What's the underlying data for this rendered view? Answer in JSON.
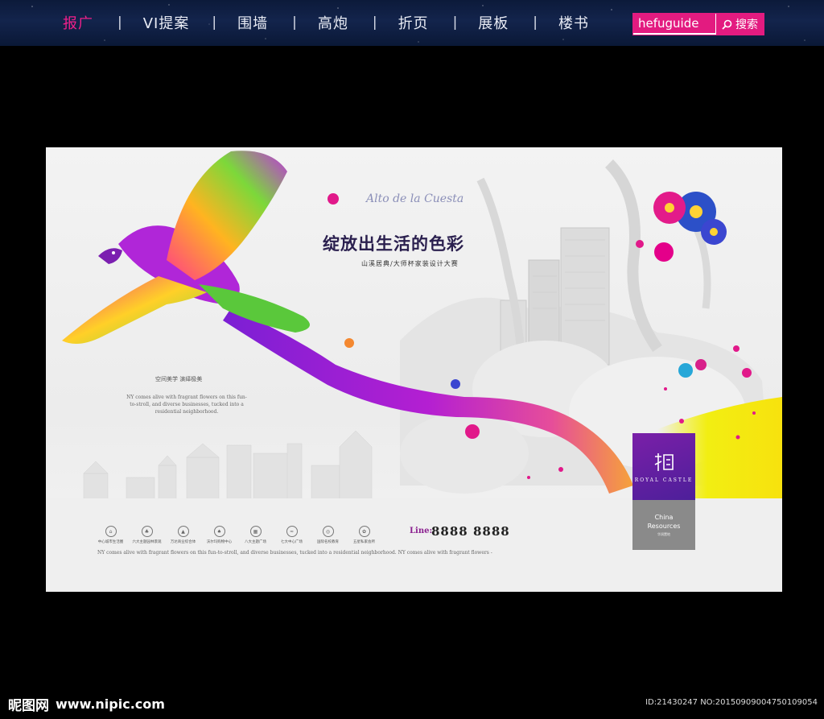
{
  "nav": {
    "items": [
      "报广",
      "VI提案",
      "围墙",
      "高炮",
      "折页",
      "展板",
      "楼书"
    ],
    "active_index": 0,
    "separator": "|"
  },
  "search": {
    "value": "hefuguide",
    "button_label": "搜索"
  },
  "poster": {
    "script_tagline": "Alto de la Cuesta",
    "headline": "绽放出生活的色彩",
    "subhead": "山溪居典/大师杯家装设计大赛",
    "left_title": "空间美学   演绎极美",
    "left_copy": "NY comes alive with fragrant flowers on this fun-to-stroll, and diverse businesses, tucked into a residential neighborhood.",
    "features": [
      {
        "icon": "building-icon",
        "label": "中心城市生活圈"
      },
      {
        "icon": "park-icon",
        "label": "六大主题园林景观"
      },
      {
        "icon": "school-icon",
        "label": "万达商业综合体"
      },
      {
        "icon": "tree-icon",
        "label": "沃尔玛购物中心"
      },
      {
        "icon": "mall-icon",
        "label": "八大主题广场"
      },
      {
        "icon": "pool-icon",
        "label": "七大中心广场"
      },
      {
        "icon": "sport-icon",
        "label": "国际名校教育"
      },
      {
        "icon": "garden-icon",
        "label": "五星私家会所"
      }
    ],
    "footer_copy": "NY comes alive with  fragrant flowers on this fun-to-stroll, and diverse businesses,  tucked into a residential neighborhood.  NY comes alive with  fragrant flowers -",
    "phone_label": "Line:",
    "phone_number": "8888 8888",
    "brand": {
      "logo_text": "ROYAL CASTLE",
      "name_line1": "China",
      "name_line2": "Resources",
      "small": "华润置地"
    }
  },
  "footer": {
    "site_name": "昵图网",
    "site_url": "www.nipic.com",
    "image_id": "ID:21430247 NO:20150909004750109054"
  },
  "colors": {
    "accent": "#e31b80",
    "nav_bg": "#13244c",
    "purple": "#7a1fa8"
  }
}
